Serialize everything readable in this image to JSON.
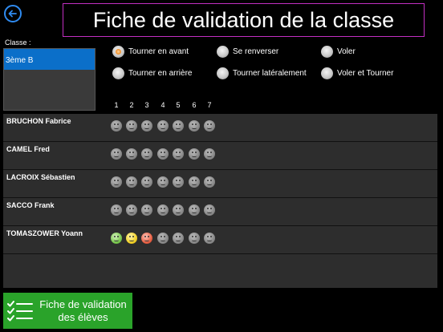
{
  "header": {
    "title": "Fiche de validation de la classe"
  },
  "classes": {
    "label": "Classe :",
    "items": [
      "3ème B"
    ],
    "selected": "3ème B"
  },
  "options": [
    {
      "label": "Tourner en avant",
      "selected": true
    },
    {
      "label": "Se renverser",
      "selected": false
    },
    {
      "label": "Voler",
      "selected": false
    },
    {
      "label": "Tourner en arrière",
      "selected": false
    },
    {
      "label": "Tourner latéralement",
      "selected": false
    },
    {
      "label": "Voler et Tourner",
      "selected": false
    }
  ],
  "columns": [
    "1",
    "2",
    "3",
    "4",
    "5",
    "6",
    "7"
  ],
  "students": [
    {
      "name": "BRUCHON Fabrice",
      "faces": [
        "neutral",
        "neutral",
        "neutral",
        "neutral",
        "neutral",
        "neutral",
        "neutral"
      ]
    },
    {
      "name": "CAMEL Fred",
      "faces": [
        "neutral",
        "neutral",
        "neutral",
        "neutral",
        "neutral",
        "neutral",
        "neutral"
      ]
    },
    {
      "name": "LACROIX Sébastien",
      "faces": [
        "neutral",
        "neutral",
        "neutral",
        "neutral",
        "neutral",
        "neutral",
        "neutral"
      ]
    },
    {
      "name": "SACCO Frank",
      "faces": [
        "neutral",
        "neutral",
        "neutral",
        "neutral",
        "neutral",
        "neutral",
        "neutral"
      ]
    },
    {
      "name": "TOMASZOWER Yoann",
      "faces": [
        "green",
        "yellow",
        "red",
        "neutral",
        "neutral",
        "neutral",
        "neutral"
      ]
    }
  ],
  "footer": {
    "validate_line1": "Fiche de validation",
    "validate_line2": "des élèves"
  },
  "colors": {
    "accent": "#2f8bf0",
    "title_border": "#c22fc2",
    "selection": "#0b6fc9",
    "button": "#2aa32a"
  }
}
